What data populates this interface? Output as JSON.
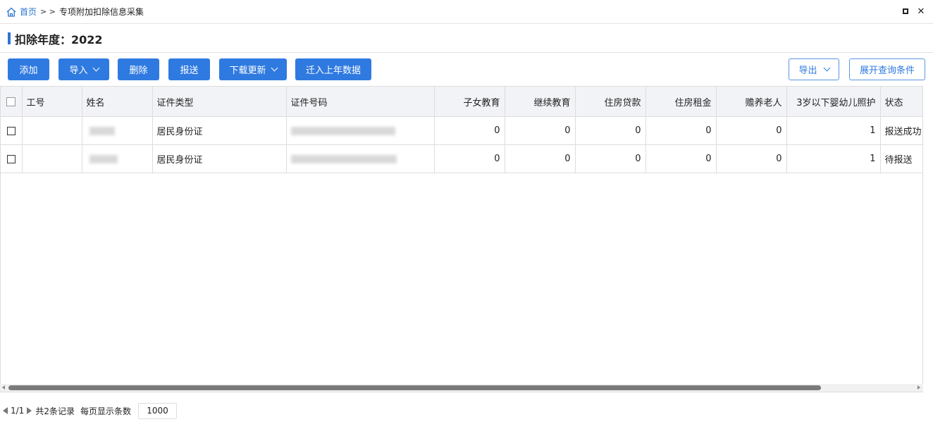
{
  "breadcrumb": {
    "home": "首页",
    "separator": "> >",
    "current": "专项附加扣除信息采集"
  },
  "year": {
    "label": "扣除年度：2022"
  },
  "toolbar": {
    "add": "添加",
    "import": "导入",
    "delete": "删除",
    "submit": "报送",
    "download_update": "下载更新",
    "migrate_last_year": "迁入上年数据",
    "export": "导出",
    "expand_query": "展开查询条件"
  },
  "table": {
    "headers": {
      "emp_no": "工号",
      "name": "姓名",
      "id_type": "证件类型",
      "id_no": "证件号码",
      "children_edu": "子女教育",
      "continuing_edu": "继续教育",
      "housing_loan": "住房贷款",
      "housing_rent": "住房租金",
      "elderly_support": "赡养老人",
      "infant_care": "3岁以下婴幼儿照护",
      "status": "状态"
    },
    "rows": [
      {
        "emp_no": "",
        "id_type": "居民身份证",
        "children_edu": "0",
        "continuing_edu": "0",
        "housing_loan": "0",
        "housing_rent": "0",
        "elderly_support": "0",
        "infant_care": "1",
        "status": "报送成功"
      },
      {
        "emp_no": "",
        "id_type": "居民身份证",
        "children_edu": "0",
        "continuing_edu": "0",
        "housing_loan": "0",
        "housing_rent": "0",
        "elderly_support": "0",
        "infant_care": "1",
        "status": "待报送"
      }
    ]
  },
  "pager": {
    "page": "1/1",
    "total": "共2条记录",
    "per_page_label": "每页显示条数",
    "per_page_value": "1000"
  },
  "colors": {
    "primary": "#2f7ae0",
    "accent": "#2f74d0",
    "header_bg": "#f2f3f7"
  }
}
